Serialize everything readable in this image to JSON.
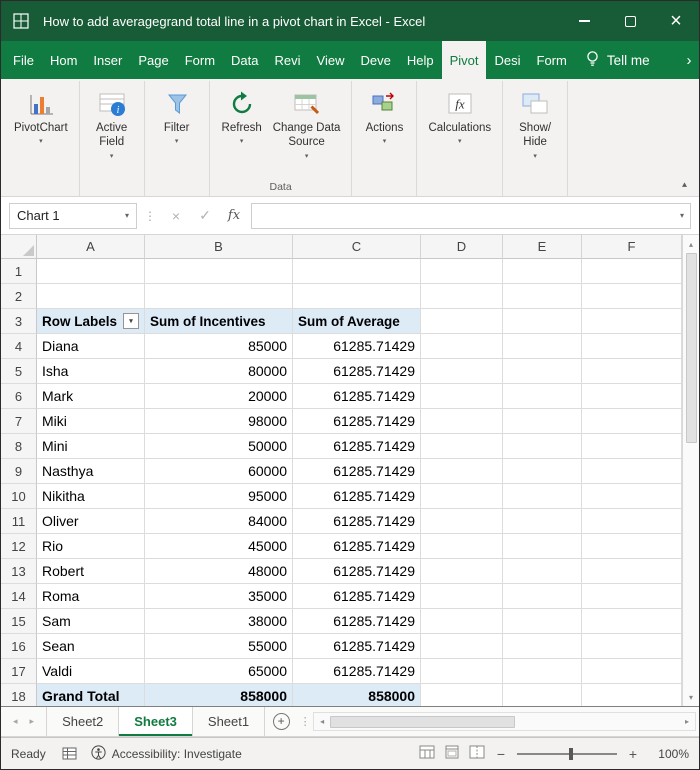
{
  "colors": {
    "title_green": "#185C37",
    "ribbon_green": "#107C41",
    "active_tab_text_green": "#0F7B40",
    "pivot_header_blue": "#DDEBF7"
  },
  "title_bar": {
    "title": "How to add averagegrand total line in a pivot chart in Excel  -  Excel"
  },
  "icons": {
    "close": "×",
    "dropdown": "▾",
    "up_arrow": "▴",
    "down_arrow": "▾",
    "left_arrow": "◂",
    "right_arrow": "▸",
    "overflow_chevron": "›",
    "separator_dots": "⋮",
    "collapse_ribbon": "▴",
    "new_sheet_plus": "+",
    "filter_dropdown": "▾",
    "zoom_minus": "−",
    "zoom_plus": "+"
  },
  "ribbon_tabs": [
    {
      "label": "File",
      "active": false
    },
    {
      "label": "Hom",
      "active": false
    },
    {
      "label": "Inser",
      "active": false
    },
    {
      "label": "Page",
      "active": false
    },
    {
      "label": "Form",
      "active": false
    },
    {
      "label": "Data",
      "active": false
    },
    {
      "label": "Revi",
      "active": false
    },
    {
      "label": "View",
      "active": false
    },
    {
      "label": "Deve",
      "active": false
    },
    {
      "label": "Help",
      "active": false
    },
    {
      "label": "Pivot",
      "active": true
    },
    {
      "label": "Desi",
      "active": false
    },
    {
      "label": "Form",
      "active": false
    }
  ],
  "tell_me": {
    "label": "Tell me"
  },
  "ribbon": {
    "groups": [
      {
        "label": "",
        "buttons": [
          {
            "name": "pivotchart",
            "icon": "pivotchart-icon",
            "lines": [
              "PivotChart"
            ]
          }
        ]
      },
      {
        "label": "",
        "buttons": [
          {
            "name": "active-field",
            "icon": "active-field-icon",
            "lines": [
              "Active",
              "Field"
            ]
          }
        ]
      },
      {
        "label": "",
        "buttons": [
          {
            "name": "filter",
            "icon": "filter-icon",
            "lines": [
              "Filter"
            ]
          }
        ]
      },
      {
        "label": "Data",
        "buttons": [
          {
            "name": "refresh",
            "icon": "refresh-icon",
            "lines": [
              "Refresh"
            ]
          },
          {
            "name": "change-data-source",
            "icon": "change-data-source-icon",
            "lines": [
              "Change Data",
              "Source"
            ]
          }
        ]
      },
      {
        "label": "",
        "buttons": [
          {
            "name": "actions",
            "icon": "actions-icon",
            "lines": [
              "Actions"
            ]
          }
        ]
      },
      {
        "label": "",
        "buttons": [
          {
            "name": "calculations",
            "icon": "calculations-icon",
            "lines": [
              "Calculations"
            ]
          }
        ]
      },
      {
        "label": "",
        "buttons": [
          {
            "name": "show-hide",
            "icon": "show-hide-icon",
            "lines": [
              "Show/",
              "Hide"
            ]
          }
        ]
      }
    ]
  },
  "formula_bar": {
    "name_box": "Chart 1",
    "cancel_icon": "×",
    "enter_icon": "✓",
    "fx": "fx",
    "value": ""
  },
  "sheet": {
    "columns": [
      "A",
      "B",
      "C",
      "D",
      "E",
      "F"
    ],
    "row_count": 18,
    "pivot": {
      "header_row": 3,
      "headers": [
        "Row Labels",
        "Sum of Incentives",
        "Sum of Average"
      ],
      "data_start_row": 4,
      "data": [
        {
          "name": "Diana",
          "incentives": "85000",
          "average": "61285.71429"
        },
        {
          "name": "Isha",
          "incentives": "80000",
          "average": "61285.71429"
        },
        {
          "name": "Mark",
          "incentives": "20000",
          "average": "61285.71429"
        },
        {
          "name": "Miki",
          "incentives": "98000",
          "average": "61285.71429"
        },
        {
          "name": "Mini",
          "incentives": "50000",
          "average": "61285.71429"
        },
        {
          "name": "Nasthya",
          "incentives": "60000",
          "average": "61285.71429"
        },
        {
          "name": "Nikitha",
          "incentives": "95000",
          "average": "61285.71429"
        },
        {
          "name": "Oliver",
          "incentives": "84000",
          "average": "61285.71429"
        },
        {
          "name": "Rio",
          "incentives": "45000",
          "average": "61285.71429"
        },
        {
          "name": "Robert",
          "incentives": "48000",
          "average": "61285.71429"
        },
        {
          "name": "Roma",
          "incentives": "35000",
          "average": "61285.71429"
        },
        {
          "name": "Sam",
          "incentives": "38000",
          "average": "61285.71429"
        },
        {
          "name": "Sean",
          "incentives": "55000",
          "average": "61285.71429"
        },
        {
          "name": "Valdi",
          "incentives": "65000",
          "average": "61285.71429"
        }
      ],
      "grand_total_row": 18,
      "grand_total": {
        "name": "Grand Total",
        "incentives": "858000",
        "average": "858000"
      }
    }
  },
  "sheet_tabs": [
    {
      "name": "Sheet2",
      "active": false
    },
    {
      "name": "Sheet3",
      "active": true
    },
    {
      "name": "Sheet1",
      "active": false
    }
  ],
  "status_bar": {
    "ready": "Ready",
    "accessibility": "Accessibility: Investigate",
    "zoom": "100%"
  }
}
